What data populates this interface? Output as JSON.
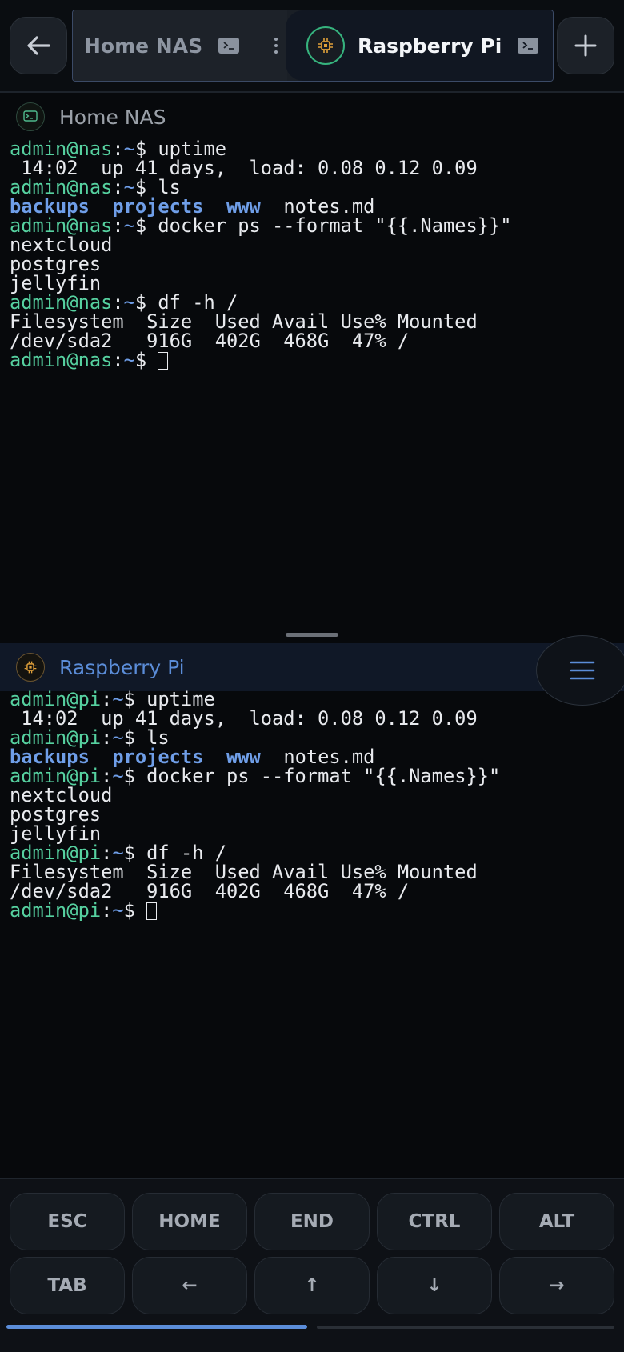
{
  "tabs": [
    {
      "title": "Home NAS",
      "active": false
    },
    {
      "title": "Raspberry Pi",
      "active": true
    }
  ],
  "icons": {
    "back": "arrow-left-icon",
    "add": "plus-icon",
    "terminal": "terminal-icon",
    "more": "kebab-icon",
    "chip": "chip-icon",
    "menu": "menu-icon"
  },
  "panes": {
    "top": {
      "title": "Home NAS",
      "prompt_user": "admin@nas",
      "cmd_uptime": "uptime",
      "uptime_out": " 14:02  up 41 days,  load: 0.08 0.12 0.09",
      "cmd_ls": "ls",
      "dir1": "backups",
      "dir2": "projects",
      "dir3": "www",
      "file1": "notes.md",
      "cmd_docker": "docker ps --format \"{{.Names}}\"",
      "container1": "nextcloud",
      "container2": "postgres",
      "container3": "jellyfin",
      "cmd_df": "df -h /",
      "df_header": "Filesystem  Size  Used Avail Use% Mounted",
      "df_row": "/dev/sda2   916G  402G  468G  47% /"
    },
    "bottom": {
      "title": "Raspberry Pi",
      "prompt_user": "admin@pi",
      "cmd_uptime": "uptime",
      "uptime_out": " 14:02  up 41 days,  load: 0.08 0.12 0.09",
      "cmd_ls": "ls",
      "dir1": "backups",
      "dir2": "projects",
      "dir3": "www",
      "file1": "notes.md",
      "cmd_docker": "docker ps --format \"{{.Names}}\"",
      "container1": "nextcloud",
      "container2": "postgres",
      "container3": "jellyfin",
      "cmd_df": "df -h /",
      "df_header": "Filesystem  Size  Used Avail Use% Mounted",
      "df_row": "/dev/sda2   916G  402G  468G  47% /"
    }
  },
  "prompt": {
    "sep": ":",
    "path": "~",
    "symbol": "$ "
  },
  "keys": {
    "row1": [
      "ESC",
      "HOME",
      "END",
      "CTRL",
      "ALT"
    ],
    "row2": [
      "TAB",
      "←",
      "↑",
      "↓",
      "→"
    ]
  },
  "keys_page": {
    "current": 1,
    "total": 2
  },
  "colors": {
    "accent": "#5b8dd9",
    "prompt_user": "#56d1a0",
    "prompt_path": "#6f9ee8",
    "background": "#07090c",
    "pi_badge_ring": "#36b37e",
    "chip": "#e0a03a"
  }
}
